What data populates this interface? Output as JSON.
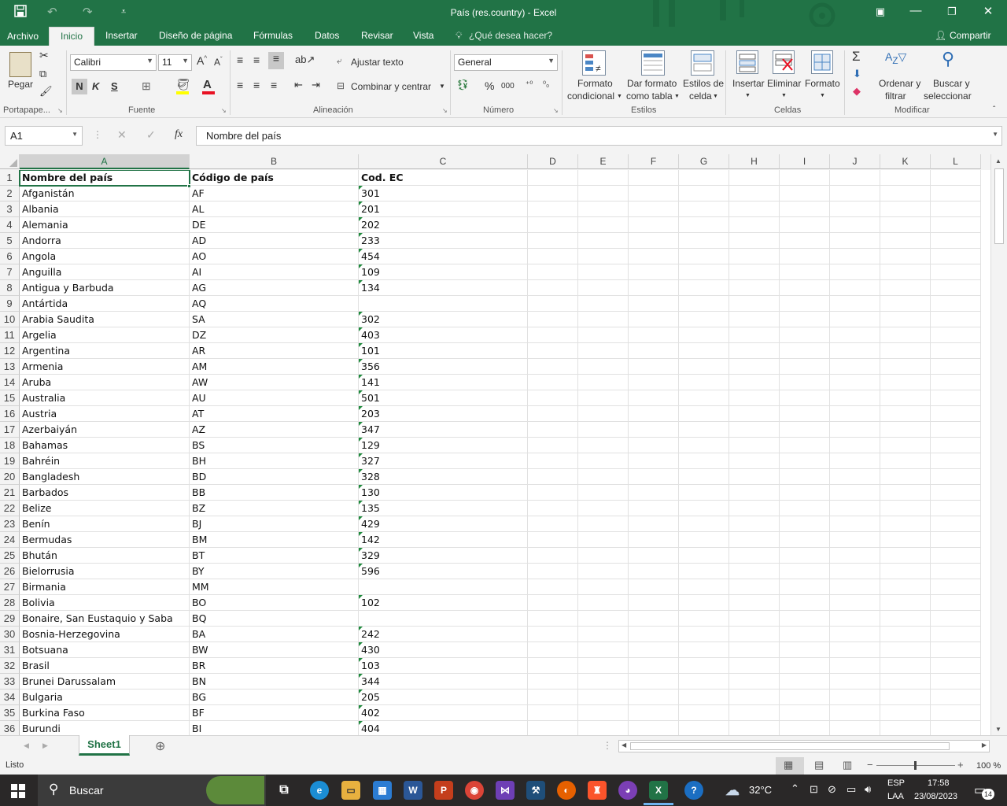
{
  "window": {
    "title": "País (res.country) - Excel"
  },
  "menu": {
    "archivo": "Archivo",
    "inicio": "Inicio",
    "insertar": "Insertar",
    "diseno": "Diseño de página",
    "formulas": "Fórmulas",
    "datos": "Datos",
    "revisar": "Revisar",
    "vista": "Vista",
    "tell_me": "¿Qué desea hacer?",
    "share": "Compartir"
  },
  "ribbon": {
    "pegar": "Pegar",
    "font_name": "Calibri",
    "font_size": "11",
    "bold": "N",
    "italic": "K",
    "underline": "S",
    "wrap_text": "Ajustar texto",
    "merge_center": "Combinar y centrar",
    "number_format": "General",
    "percent": "%",
    "thousands": "000",
    "formato_condicional_1": "Formato",
    "formato_condicional_2": "condicional",
    "dar_formato_1": "Dar formato",
    "dar_formato_2": "como tabla",
    "estilos_celda_1": "Estilos de",
    "estilos_celda_2": "celda",
    "insertar": "Insertar",
    "eliminar": "Eliminar",
    "formato": "Formato",
    "ordenar_1": "Ordenar y",
    "ordenar_2": "filtrar",
    "buscar_1": "Buscar y",
    "buscar_2": "seleccionar",
    "groups": {
      "portapapeles": "Portapape...",
      "fuente": "Fuente",
      "alineacion": "Alineación",
      "numero": "Número",
      "estilos": "Estilos",
      "celdas": "Celdas",
      "modificar": "Modificar"
    }
  },
  "formula_bar": {
    "name_box": "A1",
    "fx": "fx",
    "content": "Nombre del país"
  },
  "columns": [
    "A",
    "B",
    "C",
    "D",
    "E",
    "F",
    "G",
    "H",
    "I",
    "J",
    "K",
    "L"
  ],
  "header_row": {
    "a": "Nombre del país",
    "b": "Código de país",
    "c": "Cod. EC"
  },
  "rows": [
    {
      "n": "2",
      "a": "Afganistán",
      "b": "AF",
      "c": "301"
    },
    {
      "n": "3",
      "a": "Albania",
      "b": "AL",
      "c": "201"
    },
    {
      "n": "4",
      "a": "Alemania",
      "b": "DE",
      "c": "202"
    },
    {
      "n": "5",
      "a": "Andorra",
      "b": "AD",
      "c": "233"
    },
    {
      "n": "6",
      "a": "Angola",
      "b": "AO",
      "c": "454"
    },
    {
      "n": "7",
      "a": "Anguilla",
      "b": "AI",
      "c": "109"
    },
    {
      "n": "8",
      "a": "Antigua y Barbuda",
      "b": "AG",
      "c": "134"
    },
    {
      "n": "9",
      "a": "Antártida",
      "b": "AQ",
      "c": ""
    },
    {
      "n": "10",
      "a": "Arabia Saudita",
      "b": "SA",
      "c": "302"
    },
    {
      "n": "11",
      "a": "Argelia",
      "b": "DZ",
      "c": "403"
    },
    {
      "n": "12",
      "a": "Argentina",
      "b": "AR",
      "c": "101"
    },
    {
      "n": "13",
      "a": "Armenia",
      "b": "AM",
      "c": "356"
    },
    {
      "n": "14",
      "a": "Aruba",
      "b": "AW",
      "c": "141"
    },
    {
      "n": "15",
      "a": "Australia",
      "b": "AU",
      "c": "501"
    },
    {
      "n": "16",
      "a": "Austria",
      "b": "AT",
      "c": "203"
    },
    {
      "n": "17",
      "a": "Azerbaiyán",
      "b": "AZ",
      "c": "347"
    },
    {
      "n": "18",
      "a": "Bahamas",
      "b": "BS",
      "c": "129"
    },
    {
      "n": "19",
      "a": "Bahréin",
      "b": "BH",
      "c": "327"
    },
    {
      "n": "20",
      "a": "Bangladesh",
      "b": "BD",
      "c": "328"
    },
    {
      "n": "21",
      "a": "Barbados",
      "b": "BB",
      "c": "130"
    },
    {
      "n": "22",
      "a": "Belize",
      "b": "BZ",
      "c": "135"
    },
    {
      "n": "23",
      "a": "Benín",
      "b": "BJ",
      "c": "429"
    },
    {
      "n": "24",
      "a": "Bermudas",
      "b": "BM",
      "c": "142"
    },
    {
      "n": "25",
      "a": "Bhután",
      "b": "BT",
      "c": "329"
    },
    {
      "n": "26",
      "a": "Bielorrusia",
      "b": "BY",
      "c": "596"
    },
    {
      "n": "27",
      "a": "Birmania",
      "b": "MM",
      "c": ""
    },
    {
      "n": "28",
      "a": "Bolivia",
      "b": "BO",
      "c": "102"
    },
    {
      "n": "29",
      "a": "Bonaire, San Eustaquio y Saba",
      "b": "BQ",
      "c": ""
    },
    {
      "n": "30",
      "a": "Bosnia-Herzegovina",
      "b": "BA",
      "c": "242"
    },
    {
      "n": "31",
      "a": "Botsuana",
      "b": "BW",
      "c": "430"
    },
    {
      "n": "32",
      "a": "Brasil",
      "b": "BR",
      "c": "103"
    },
    {
      "n": "33",
      "a": "Brunei Darussalam",
      "b": "BN",
      "c": "344"
    },
    {
      "n": "34",
      "a": "Bulgaria",
      "b": "BG",
      "c": "205"
    },
    {
      "n": "35",
      "a": "Burkina Faso",
      "b": "BF",
      "c": "402"
    },
    {
      "n": "36",
      "a": "Burundi",
      "b": "BI",
      "c": "404"
    }
  ],
  "sheet_tab": "Sheet1",
  "status": {
    "ready": "Listo",
    "zoom": "100 %"
  },
  "taskbar": {
    "search": "Buscar",
    "weather": "32°C",
    "lang_1": "ESP",
    "lang_2": "LAA",
    "time": "17:58",
    "date": "23/08/2023",
    "notifications": "14"
  },
  "colors": {
    "excel_green": "#217346",
    "triangle": "#1e8a3c"
  }
}
